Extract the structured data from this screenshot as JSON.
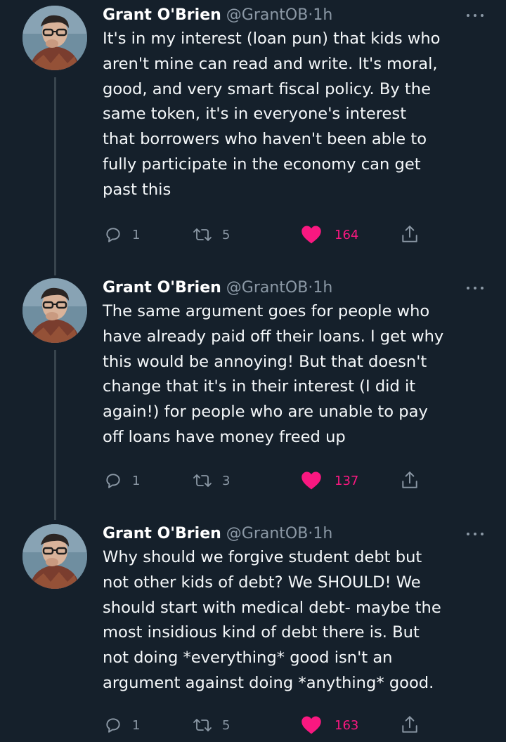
{
  "colors": {
    "background": "#15202b",
    "text": "#ffffff",
    "muted": "#8b98a5",
    "like": "#f91880",
    "thread_line": "#38444d"
  },
  "tweets": [
    {
      "author": {
        "name": "Grant O'Brien",
        "handle": "@GrantOB",
        "separator": "·",
        "time": "1h",
        "avatar_icon": "avatar-icon"
      },
      "text": "It's in my interest (loan pun) that kids who\naren't mine can read and write. It's moral,\ngood, and very smart fiscal policy. By the\nsame token, it's in everyone's interest\nthat borrowers who haven't been able to\nfully participate in the economy can get\npast this",
      "replies": "1",
      "retweets": "5",
      "likes": "164",
      "liked": true
    },
    {
      "author": {
        "name": "Grant O'Brien",
        "handle": "@GrantOB",
        "separator": "·",
        "time": "1h",
        "avatar_icon": "avatar-icon"
      },
      "text": "The same argument goes for people who\nhave already paid off their loans. I get why\nthis would be annoying! But that doesn't\nchange that it's in their  interest (I did it\nagain!) for people who are unable to pay\noff loans have money freed up",
      "replies": "1",
      "retweets": "3",
      "likes": "137",
      "liked": true
    },
    {
      "author": {
        "name": "Grant O'Brien",
        "handle": "@GrantOB",
        "separator": "·",
        "time": "1h",
        "avatar_icon": "avatar-icon"
      },
      "text": "Why should we forgive student debt but\nnot other kids of debt? We SHOULD! We\nshould start with medical debt- maybe the\nmost insidious kind of debt there is. But\nnot doing *everything* good isn't an\nargument against doing *anything* good.",
      "replies": "1",
      "retweets": "5",
      "likes": "163",
      "liked": true
    }
  ]
}
